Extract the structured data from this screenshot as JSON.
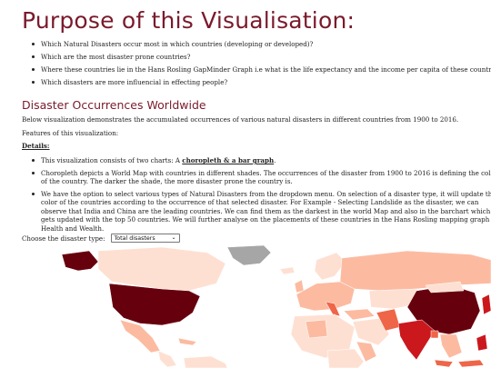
{
  "page_title": "Purpose of this Visualisation:",
  "purpose_items": [
    "Which Natural Disasters occur most in which countries (developing or developed)?",
    "Which are the most disaster prone countries?",
    "Where these countries lie in the Hans Rosling GapMinder Graph i.e what is the life expectancy and the income per capita of these countries?",
    "Which disasters are more influencial in effecting people?"
  ],
  "section_title": "Disaster Occurrences Worldwide",
  "intro_text": "Below visualization demonstrates the accumulated occurrences of various natural disasters in different countries from 1900 to 2016.",
  "features_label": "Features of this visualization:",
  "details_label": "Details:",
  "details": {
    "item1_prefix": "This visualization consists of two charts: A ",
    "item1_link": "choropleth & a bar graph",
    "item1_suffix": ".",
    "item2": "Choropleth depicts a World Map with countries in different shades. The occurrences of the disaster from 1900 to 2016 is defining the color of the country. The darker the shade, the more disaster prone the country is.",
    "item3": "We have the option to select various types of Natural Disasters from the dropdown menu. On selection of a disaster type, it will update the color of the countries according to the occurrence of that selected disaster. For Example - Selecting Landslide as the disaster, we can observe that India and China are the leading countries. We can find them as the darkest in the world Map and also in the barchart which gets updated with the top 50 countries. We will further analyse on the placements of these countries in the Hans Rosling mapping graph of Health and Wealth."
  },
  "chooser": {
    "label": "Choose the disaster type:",
    "selected": "Total disasters",
    "chevron_icon": "chevron-down-icon"
  },
  "colors": {
    "heading": "#7a1a2b",
    "darkest": "#67000d",
    "dark": "#cb181d",
    "medium": "#ef6548",
    "light": "#fcbba1",
    "lightest": "#fee0d2",
    "no_data": "#a6a6a6"
  }
}
